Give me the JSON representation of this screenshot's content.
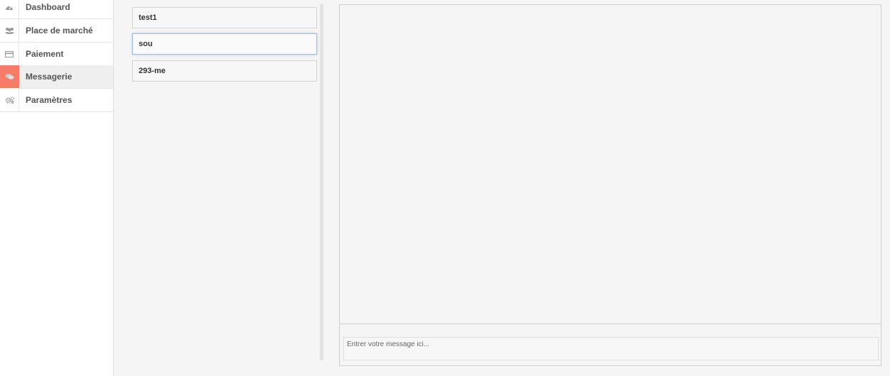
{
  "sidebar": {
    "items": [
      {
        "label": "Dashboard",
        "icon": "dashboard-icon",
        "active": false
      },
      {
        "label": "Place de marché",
        "icon": "users-icon",
        "active": false
      },
      {
        "label": "Paiement",
        "icon": "credit-card-icon",
        "active": false
      },
      {
        "label": "Messagerie",
        "icon": "chat-bubbles-icon",
        "active": true
      },
      {
        "label": "Paramètres",
        "icon": "gears-icon",
        "active": false
      }
    ],
    "active_color": "#f77b65"
  },
  "conversations": [
    {
      "label": "test1",
      "selected": false
    },
    {
      "label": "sou",
      "selected": true
    },
    {
      "label": "293-me",
      "selected": false
    }
  ],
  "chat": {
    "input_placeholder": "Entrer votre message ici..."
  }
}
